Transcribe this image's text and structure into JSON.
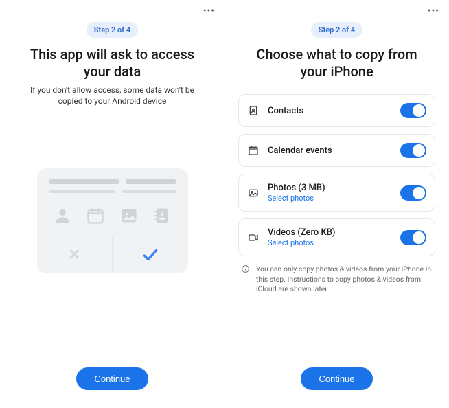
{
  "left": {
    "step_badge": "Step 2 of 4",
    "title": "This app will ask to access your data",
    "subtitle": "If you don't allow access, some data won't be copied to your Android device",
    "continue": "Continue"
  },
  "right": {
    "step_badge": "Step 2 of 4",
    "title": "Choose what to copy from your iPhone",
    "options": [
      {
        "label": "Contacts",
        "link": "",
        "toggle": true
      },
      {
        "label": "Calendar events",
        "link": "",
        "toggle": true
      },
      {
        "label": "Photos (3 MB)",
        "link": "Select photos",
        "toggle": true
      },
      {
        "label": "Videos (Zero KB)",
        "link": "Select photos",
        "toggle": true
      }
    ],
    "info": "You can only copy photos & videos from your iPhone in this step. Instructions to copy photos & videos from iCloud are shown later.",
    "continue": "Continue"
  }
}
